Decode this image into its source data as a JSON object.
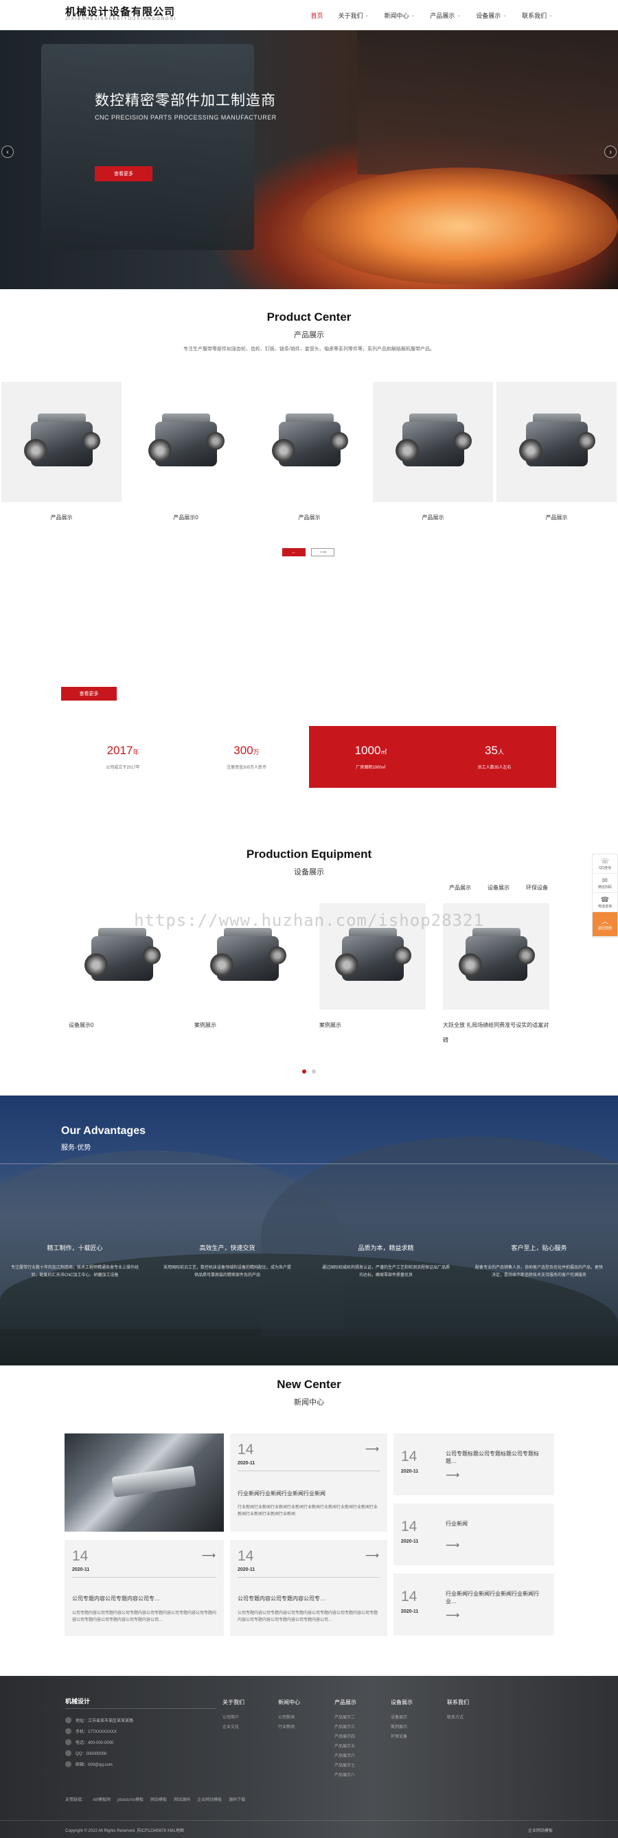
{
  "header": {
    "logo_cn": "机械设计设备有限公司",
    "logo_en": "JIXIESHEJISHEBEIYOUXIANGONGSI",
    "nav": [
      {
        "label": "首页",
        "dropdown": false,
        "active": true
      },
      {
        "label": "关于我们",
        "dropdown": true
      },
      {
        "label": "新闻中心",
        "dropdown": true
      },
      {
        "label": "产品展示",
        "dropdown": true
      },
      {
        "label": "设备展示",
        "dropdown": true
      },
      {
        "label": "联系我们",
        "dropdown": true
      }
    ]
  },
  "banner": {
    "title": "数控精密零部件加工制造商",
    "subtitle": "CNC PRECISION PARTS PROCESSING MANUFACTURER",
    "button": "查看更多",
    "prev": "‹",
    "next": "›"
  },
  "products": {
    "title": "Product Center",
    "subtitle": "产品展示",
    "desc": "专注生产履带零部件如涨齿轮、齿轮、钉板、链条/销件、套管头、轴承等系列零件等，系列产品和解结解机履带产品。",
    "items": [
      {
        "label": "产品展示"
      },
      {
        "label": "产品展示0"
      },
      {
        "label": "产品展示"
      },
      {
        "label": "产品展示"
      },
      {
        "label": "产品展示"
      }
    ],
    "pager_prev": "←",
    "pager_next": "⟶"
  },
  "about": {
    "button": "查看更多",
    "stats": [
      {
        "num": "2017",
        "unit": "年",
        "label": "公司成立于2017年"
      },
      {
        "num": "300",
        "unit": "万",
        "label": "注册资金300万人民币"
      },
      {
        "num": "1000",
        "unit": "㎡",
        "label": "厂房面积1000㎡"
      },
      {
        "num": "35",
        "unit": "人",
        "label": "员工人数35人左右"
      }
    ]
  },
  "equipment": {
    "title": "Production Equipment",
    "subtitle": "设备展示",
    "tabs": [
      "产品展示",
      "设备展示",
      "环保设备"
    ],
    "items": [
      {
        "label": "设备展示0"
      },
      {
        "label": "案例展示"
      },
      {
        "label": "案例展示"
      },
      {
        "label": "大跃全放 扎局场绩给同费准号设实的适富对碍"
      }
    ],
    "watermark": "https://www.huzhan.com/ishop28321"
  },
  "side_float": [
    {
      "icon": "☏",
      "label": "QQ咨询"
    },
    {
      "icon": "✉",
      "label": "微信扫码"
    },
    {
      "icon": "☎",
      "label": "电话咨询"
    },
    {
      "icon": "︿",
      "label": "返回顶部"
    }
  ],
  "advantages": {
    "title": "Our Advantages",
    "subtitle": "服务·优势",
    "items": [
      {
        "title": "精工制作，十载匠心",
        "desc": "专注履带行业数十年的加工制造商，技术工程师精通各类专业上操作经验，配套的汇天冲CNC加工中心、研磨加工设备"
      },
      {
        "title": "高效生产，快速交货",
        "desc": "采用国际前沿工艺，数控机床设备领域和设备的精纯配比，成为各户提供品质可靠原装的精密部件及的产品"
      },
      {
        "title": "品质为本，精益求精",
        "desc": "通过国际权威机构颁发认证，严谨的生产工艺和检测流程保证出厂品质均达标，确保零部件质量优良"
      },
      {
        "title": "客户至上，贴心服务",
        "desc": "配备专业的产品销售人员，协助客户选型及优化并拍摄品的产品，更快决定，是持续不断追踪技术支持服务的客户完满服务"
      }
    ]
  },
  "news": {
    "title": "New Center",
    "subtitle": "新闻中心",
    "arrow": "⟶",
    "featured": {
      "day": "14",
      "month": "2020-11",
      "title": "行业新闻行业新闻行业新闻行业新闻",
      "desc": "行业新闻行业新闻行业新闻行业新闻行业新闻行业新闻行业新闻行业新闻行业新闻行业新闻行业新闻行业新闻"
    },
    "bottom": [
      {
        "day": "14",
        "month": "2020-11",
        "title": "公司专题内容公司专题内容公司专…",
        "desc": "公司专题内容公司专题内容公司专题内容公司专题内容公司专题内容公司专题内容公司专题内容公司专题内容公司专题内容公司…"
      },
      {
        "day": "14",
        "month": "2020-11",
        "title": "公司专题内容公司专题内容公司专…",
        "desc": "公司专题内容公司专题内容公司专题内容公司专题内容公司专题内容公司专题内容公司专题内容公司专题内容公司专题内容公司…"
      }
    ],
    "right": [
      {
        "day": "14",
        "month": "2020-11",
        "title": "公司专题标题公司专题标题公司专题标题…"
      },
      {
        "day": "14",
        "month": "2020-11",
        "title": "行业新闻"
      },
      {
        "day": "14",
        "month": "2020-11",
        "title": "行业新闻行业新闻行业新闻行业新闻行业…"
      }
    ]
  },
  "footer": {
    "logo": "机械设计",
    "contacts": [
      "地址：江苏省某市某区某某某路",
      "手机：177XXXXXXXX",
      "电话：400-000-0000",
      "QQ：000000000",
      "邮箱：000@qq.com"
    ],
    "columns": [
      {
        "title": "关于我们",
        "items": [
          "公司简介",
          "企业文化"
        ]
      },
      {
        "title": "新闻中心",
        "items": [
          "公司新闻",
          "行业新闻"
        ]
      },
      {
        "title": "产品展示",
        "items": [
          "产品展示二",
          "产品展示三",
          "产品展示四",
          "产品展示五",
          "产品展示六",
          "产品展示七",
          "产品展示八"
        ]
      },
      {
        "title": "设备展示",
        "items": [
          "设备展示",
          "案例展示",
          "环保设备"
        ]
      },
      {
        "title": "联系我们",
        "items": [
          "联系方式"
        ]
      }
    ],
    "links": [
      "友情链接：",
      "AB模板网",
      "pbootcms模板",
      "网站模板",
      "网站源码",
      "企业网站模板",
      "源码下载"
    ],
    "copyright": "Copyright © 2022 All Rights Reserved. 苏ICP12345678  XML地图",
    "right": "企业网站模板"
  },
  "colors": {
    "accent": "#c8161d",
    "side_top": "#f08a3a"
  }
}
